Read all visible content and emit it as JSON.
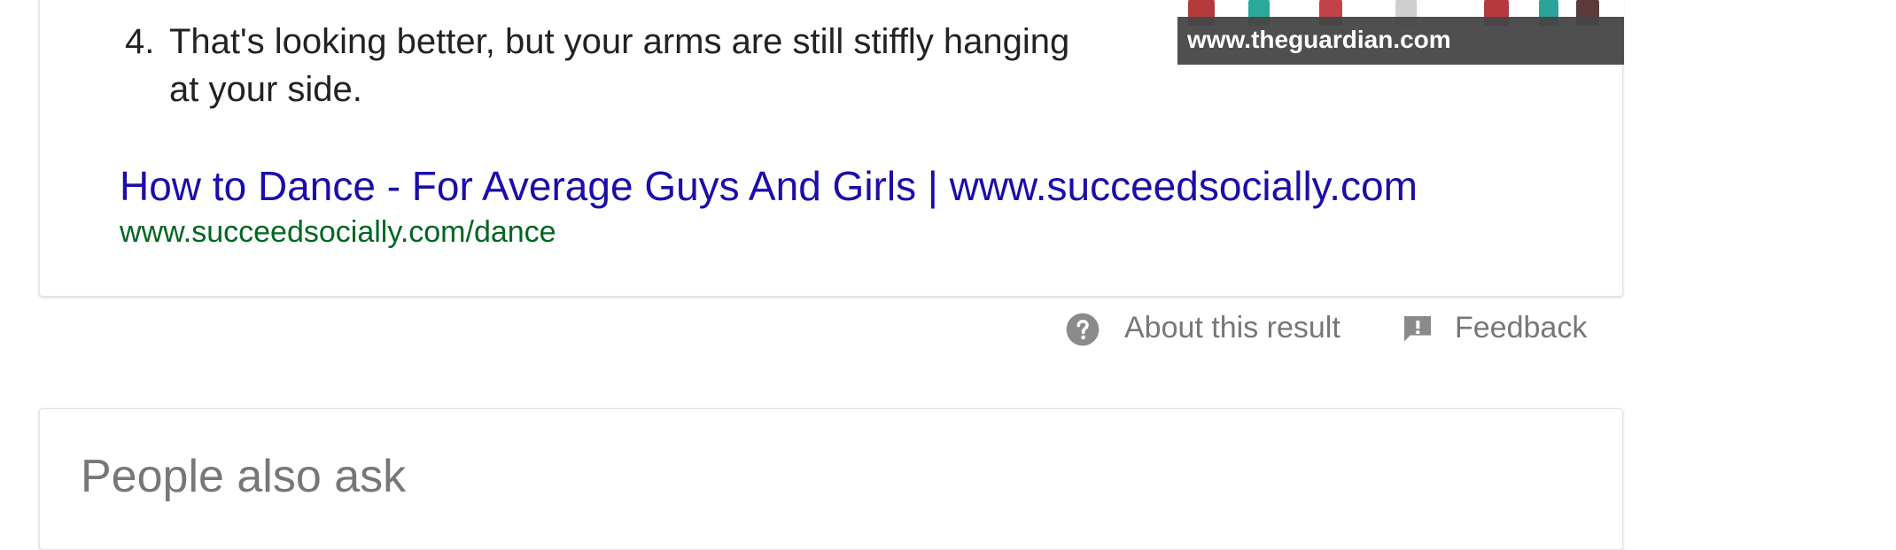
{
  "snippet": {
    "list_number": "4.",
    "list_text": "That's looking better, but your arms are still stiffly hanging at your side.",
    "result_title": "How to Dance - For Average Guys And Girls | www.succeedsocially.com",
    "result_url": "www.succeedsocially.com/dance",
    "image_caption": "www.theguardian.com"
  },
  "meta": {
    "about_label": "About this result",
    "feedback_label": "Feedback"
  },
  "paa": {
    "title": "People also ask"
  },
  "colors": {
    "link_title": "#1a0dab",
    "link_url": "#006621",
    "muted": "#777777",
    "caption_bar": "#464646"
  },
  "icons": {
    "about": "help-circle-icon",
    "feedback": "feedback-icon"
  }
}
